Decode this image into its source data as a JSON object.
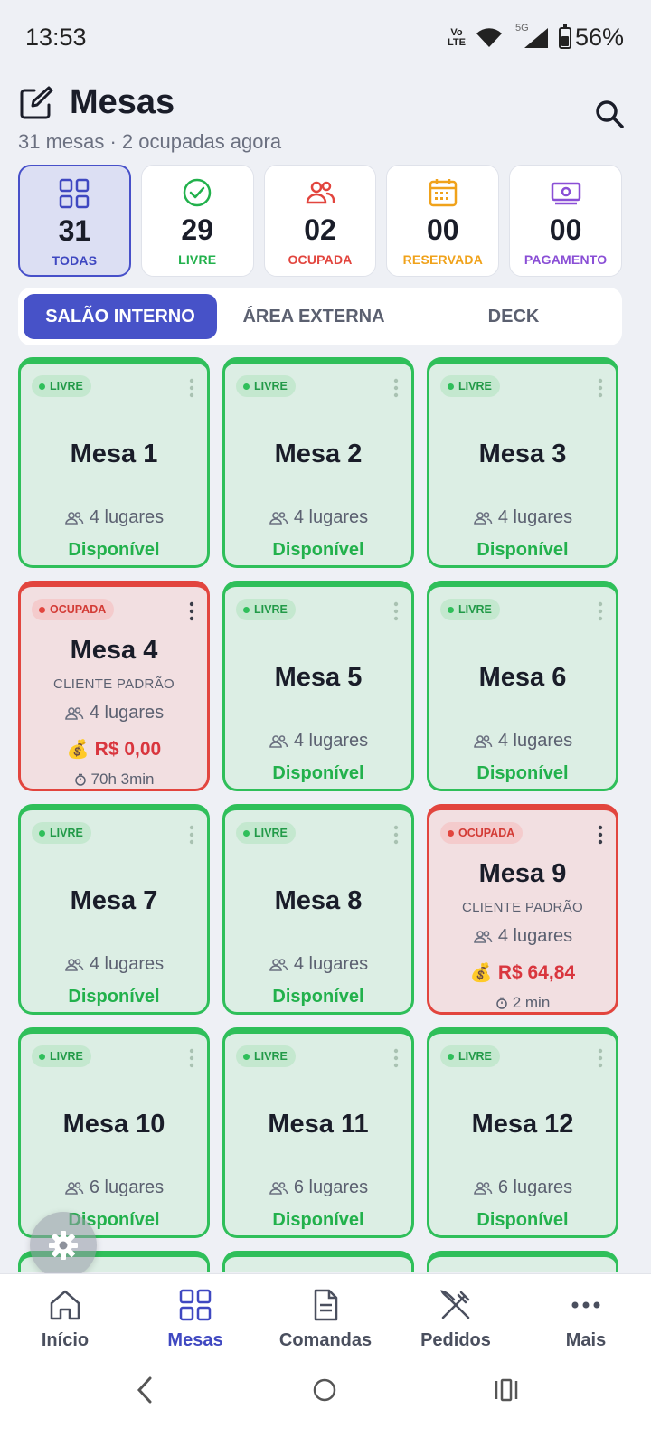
{
  "status_bar": {
    "time": "13:53",
    "volte": "Vo LTE",
    "network": "5G",
    "battery": "56%"
  },
  "header": {
    "title": "Mesas",
    "subtitle": "31 mesas · 2 ocupadas agora"
  },
  "stats": [
    {
      "count": "31",
      "label": "TODAS",
      "color": "#3f48c1",
      "icon": "grid-icon"
    },
    {
      "count": "29",
      "label": "LIVRE",
      "color": "#22b14c",
      "icon": "check-circle-icon"
    },
    {
      "count": "02",
      "label": "OCUPADA",
      "color": "#e2453e",
      "icon": "users-icon"
    },
    {
      "count": "00",
      "label": "RESERVADA",
      "color": "#f0a21a",
      "icon": "calendar-icon"
    },
    {
      "count": "00",
      "label": "PAGAMENTO",
      "color": "#8a4fd6",
      "icon": "cash-icon"
    }
  ],
  "tabs": [
    "SALÃO INTERNO",
    "ÁREA EXTERNA",
    "DECK"
  ],
  "tables": [
    {
      "name": "Mesa 1",
      "badge": "LIVRE",
      "seats": "4 lugares",
      "status": "Disponível"
    },
    {
      "name": "Mesa 2",
      "badge": "LIVRE",
      "seats": "4 lugares",
      "status": "Disponível"
    },
    {
      "name": "Mesa 3",
      "badge": "LIVRE",
      "seats": "4 lugares",
      "status": "Disponível"
    },
    {
      "name": "Mesa 4",
      "badge": "OCUPADA",
      "client": "CLIENTE PADRÃO",
      "seats": "4 lugares",
      "amount": "R$ 0,00",
      "time": "70h 3min"
    },
    {
      "name": "Mesa 5",
      "badge": "LIVRE",
      "seats": "4 lugares",
      "status": "Disponível"
    },
    {
      "name": "Mesa 6",
      "badge": "LIVRE",
      "seats": "4 lugares",
      "status": "Disponível"
    },
    {
      "name": "Mesa 7",
      "badge": "LIVRE",
      "seats": "4 lugares",
      "status": "Disponível"
    },
    {
      "name": "Mesa 8",
      "badge": "LIVRE",
      "seats": "4 lugares",
      "status": "Disponível"
    },
    {
      "name": "Mesa 9",
      "badge": "OCUPADA",
      "client": "CLIENTE PADRÃO",
      "seats": "4 lugares",
      "amount": "R$ 64,84",
      "time": "2 min"
    },
    {
      "name": "Mesa 10",
      "badge": "LIVRE",
      "seats": "6 lugares",
      "status": "Disponível"
    },
    {
      "name": "Mesa 11",
      "badge": "LIVRE",
      "seats": "6 lugares",
      "status": "Disponível"
    },
    {
      "name": "Mesa 12",
      "badge": "LIVRE",
      "seats": "6 lugares",
      "status": "Disponível"
    }
  ],
  "bottom_nav": [
    "Início",
    "Mesas",
    "Comandas",
    "Pedidos",
    "Mais"
  ],
  "colors": {
    "accent": "#4752c8",
    "free": "#2fbf5a",
    "busy": "#e2453e"
  }
}
